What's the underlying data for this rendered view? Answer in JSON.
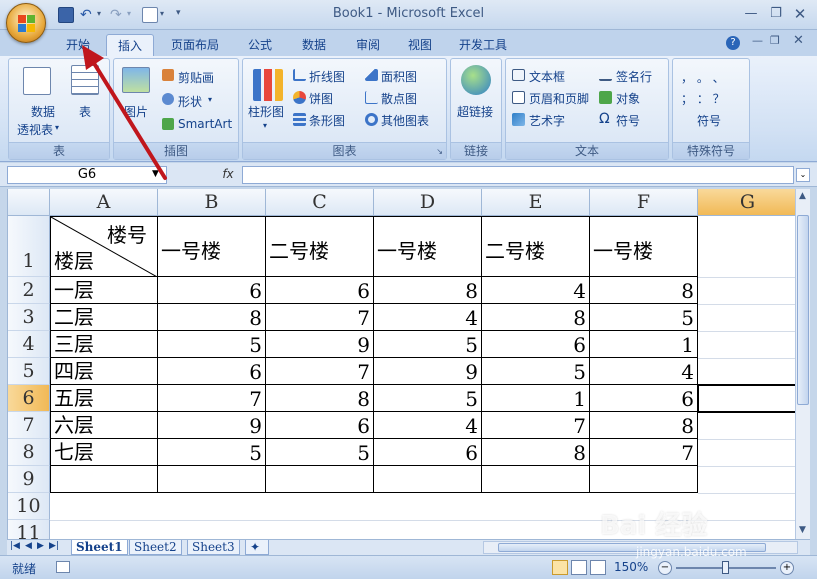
{
  "window": {
    "title": "Book1 - Microsoft Excel"
  },
  "tabs": [
    "开始",
    "插入",
    "页面布局",
    "公式",
    "数据",
    "审阅",
    "视图",
    "开发工具"
  ],
  "active_tab": "插入",
  "ribbon": {
    "groups": {
      "table": {
        "label": "表",
        "pivot": "数据\n透视表",
        "pivot_line1": "数据",
        "pivot_line2": "透视表",
        "table": "表"
      },
      "illustrations": {
        "label": "插图",
        "picture": "图片",
        "clipart": "剪贴画",
        "shapes": "形状",
        "smartart": "SmartArt"
      },
      "charts": {
        "label": "图表",
        "column": "柱形图",
        "line": "折线图",
        "pie": "饼图",
        "bar": "条形图",
        "area": "面积图",
        "scatter": "散点图",
        "other": "其他图表"
      },
      "links": {
        "label": "链接",
        "hyperlink": "超链接"
      },
      "text": {
        "label": "文本",
        "textbox": "文本框",
        "header_footer": "页眉和页脚",
        "wordart": "艺术字",
        "signature": "签名行",
        "object": "对象",
        "symbol": "符号"
      },
      "special": {
        "label": "特殊符号",
        "symbol": "符号",
        "chars_row1": "，  。  、",
        "chars_row2": "；  ：  ？"
      }
    }
  },
  "formula_bar": {
    "name_box": "G6",
    "fx": "fx",
    "value": ""
  },
  "sheet": {
    "columns": [
      "A",
      "B",
      "C",
      "D",
      "E",
      "F",
      "G"
    ],
    "selected_column": "G",
    "selected_row": "6",
    "row_numbers": [
      "1",
      "2",
      "3",
      "4",
      "5",
      "6",
      "7",
      "8",
      "9",
      "10",
      "11"
    ],
    "header_row": {
      "corner_top": "楼号",
      "corner_bottom": "楼层",
      "buildings": [
        "一号楼",
        "二号楼",
        "一号楼",
        "二号楼",
        "一号楼"
      ]
    },
    "rows": [
      {
        "label": "一层",
        "values": [
          "6",
          "6",
          "8",
          "4",
          "8"
        ]
      },
      {
        "label": "二层",
        "values": [
          "8",
          "7",
          "4",
          "8",
          "5"
        ]
      },
      {
        "label": "三层",
        "values": [
          "5",
          "9",
          "5",
          "6",
          "1"
        ]
      },
      {
        "label": "四层",
        "values": [
          "6",
          "7",
          "9",
          "5",
          "4"
        ]
      },
      {
        "label": "五层",
        "values": [
          "7",
          "8",
          "5",
          "1",
          "6"
        ]
      },
      {
        "label": "六层",
        "values": [
          "9",
          "6",
          "4",
          "7",
          "8"
        ]
      },
      {
        "label": "七层",
        "values": [
          "5",
          "5",
          "6",
          "8",
          "7"
        ]
      }
    ]
  },
  "sheet_tabs": [
    "Sheet1",
    "Sheet2",
    "Sheet3"
  ],
  "active_sheet": "Sheet1",
  "status": {
    "ready": "就绪",
    "zoom": "150%"
  },
  "watermark": {
    "main": "Bai 经验",
    "sub": "jingyan.baidu.com"
  },
  "colors": {
    "accent": "#15428b",
    "selected_header": "#f1b956",
    "arrow": "#c0161c"
  }
}
